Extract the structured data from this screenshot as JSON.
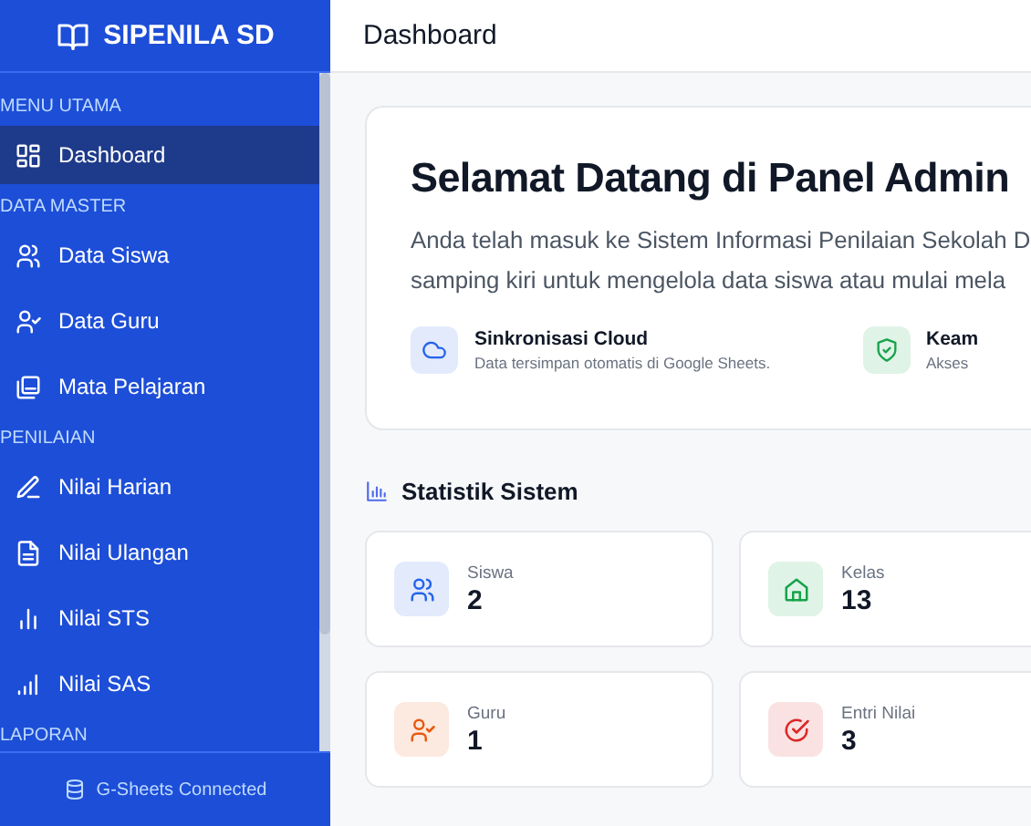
{
  "sidebar": {
    "brand": "SIPENILA SD",
    "sections": [
      {
        "title": "MENU UTAMA",
        "items": [
          {
            "label": "Dashboard",
            "selected": true
          }
        ]
      },
      {
        "title": "DATA MASTER",
        "items": [
          {
            "label": "Data Siswa",
            "selected": false
          },
          {
            "label": "Data Guru",
            "selected": false
          },
          {
            "label": "Mata Pelajaran",
            "selected": false
          }
        ]
      },
      {
        "title": "PENILAIAN",
        "items": [
          {
            "label": "Nilai Harian",
            "selected": false
          },
          {
            "label": "Nilai Ulangan",
            "selected": false
          },
          {
            "label": "Nilai STS",
            "selected": false
          },
          {
            "label": "Nilai SAS",
            "selected": false
          }
        ]
      },
      {
        "title": "LAPORAN"
      }
    ],
    "footer": "G-Sheets Connected"
  },
  "header": {
    "title": "Dashboard"
  },
  "welcome": {
    "title": "Selamat Datang di Panel Admin",
    "lines": [
      "Anda telah masuk ke Sistem Informasi Penilaian Sekolah D",
      "samping kiri untuk mengelola data siswa atau mulai mela"
    ],
    "features": [
      {
        "color": "#2563eb",
        "title": "Sinkronisasi Cloud",
        "desc": "Data tersimpan otomatis di Google Sheets."
      },
      {
        "color": "#16a34a",
        "title": "Keam",
        "desc": "Akses"
      }
    ]
  },
  "stats": {
    "title": "Statistik Sistem",
    "cards": [
      {
        "color": "#2563eb",
        "label": "Siswa",
        "value": "2"
      },
      {
        "color": "#16a34a",
        "label": "Kelas",
        "value": "13"
      },
      {
        "color": "#ea580c",
        "label": "Guru",
        "value": "1"
      },
      {
        "color": "#dc2626",
        "label": "Entri Nilai",
        "value": "3"
      }
    ]
  }
}
